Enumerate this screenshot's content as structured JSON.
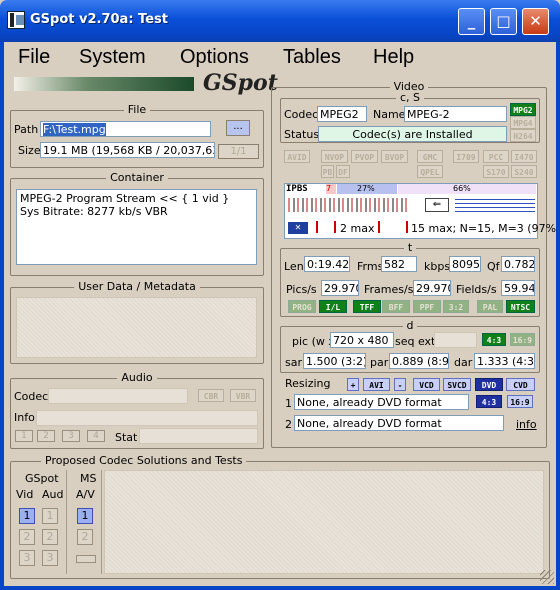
{
  "window": {
    "title": "GSpot v2.70a: Test",
    "minimize": "_",
    "maximize": "□",
    "close": "✕"
  },
  "menu": [
    "File",
    "System",
    "Options",
    "Tables",
    "Help"
  ],
  "logo_text": "GSpot",
  "file": {
    "group_title": "File",
    "path_label": "Path",
    "path_value": "F:\\Test.mpg",
    "browse_label": "...",
    "size_label": "Size",
    "size_value": "19.1 MB (19,568 KB / 20,037,632 b",
    "part_value": "1/1"
  },
  "container": {
    "group_title": "Container",
    "lines": [
      "MPEG-2 Program Stream << { 1 vid }",
      "Sys Bitrate: 8277 kb/s VBR"
    ]
  },
  "user_data": {
    "group_title": "User Data / Metadata"
  },
  "audio": {
    "group_title": "Audio",
    "codec_label": "Codec",
    "info_label": "Info",
    "stat_label": "Stat",
    "cbr": "CBR",
    "vbr": "VBR",
    "buttons": [
      "1",
      "2",
      "3",
      "4"
    ]
  },
  "video": {
    "group_title": "Video",
    "cs_label": "c, S",
    "codec_label": "Codec",
    "codec_value": "MPEG2",
    "name_label": "Name",
    "name_value": "MPEG-2",
    "status_label": "Status",
    "status_value": "Codec(s) are Installed",
    "codec_tags": [
      "MPG2",
      "MPG4",
      "H264"
    ],
    "flag_row1": [
      "AVID",
      "NVOP",
      "PVOP",
      "BVOP",
      "GMC",
      "I709",
      "PCC",
      "I470"
    ],
    "flag_row2": [
      "PB",
      "DF",
      "QPEL",
      "S170",
      "S240"
    ],
    "gop_letters": [
      "I",
      "P",
      "B",
      "S"
    ],
    "gop_num": "7",
    "gop_pct1": "27%",
    "gop_pct2": "66%",
    "bframe_text": "2 max",
    "iframe_text": "15 max; N=15, M=3 (97%",
    "t_label": "t",
    "len_label": "Len",
    "len_value": "0:19.420",
    "frms_label": "Frms",
    "frms_value": "582",
    "kbps_label": "kbps",
    "kbps_value": "8095",
    "qf_label": "Qf",
    "qf_value": "0.782",
    "pics_label": "Pics/s",
    "pics_value": "29.970",
    "frames_label": "Frames/s",
    "frames_value": "29.970",
    "fields_label": "Fields/s",
    "fields_value": "59.94",
    "t_tags": [
      "PROG",
      "I/L",
      "TFF",
      "BFF",
      "PPF",
      "3:2",
      "PAL",
      "NTSC"
    ],
    "d_label": "d",
    "pic_label": "pic (w x",
    "pic_value": "720 x 480",
    "seq_label": "seq ext",
    "ar_tags": [
      "4:3",
      "16:9"
    ],
    "sar_label": "sar",
    "sar_value": "1.500 (3:2)",
    "par_label": "par",
    "par_value": "0.889 (8:9)",
    "dar_label": "dar",
    "dar_value": "1.333 (4:3)",
    "resizing_label": "Resizing",
    "resize_tags": [
      "+",
      "AVI",
      "-",
      "VCD",
      "SVCD",
      "DVD",
      "CVD"
    ],
    "r1_num": "1",
    "r1_value": "None, already DVD format",
    "r1_tags": [
      "4:3",
      "16:9"
    ],
    "r2_num": "2",
    "r2_value": "None, already DVD format",
    "info_link": "info"
  },
  "proposed": {
    "group_title": "Proposed Codec Solutions and Tests",
    "gspot_label": "GSpot",
    "vid_label": "Vid",
    "aud_label": "Aud",
    "ms_label": "MS",
    "av_label": "A/V",
    "buttons": [
      "1",
      "2",
      "3"
    ]
  }
}
